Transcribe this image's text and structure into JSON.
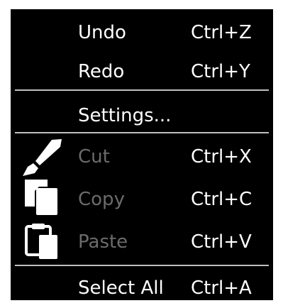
{
  "menu": {
    "undo": {
      "label": "Undo",
      "shortcut": "Ctrl+Z"
    },
    "redo": {
      "label": "Redo",
      "shortcut": "Ctrl+Y"
    },
    "settings": {
      "label": "Settings..."
    },
    "cut": {
      "label": "Cut",
      "shortcut": "Ctrl+X",
      "icon": "brush-icon",
      "enabled": false
    },
    "copy": {
      "label": "Copy",
      "shortcut": "Ctrl+C",
      "icon": "copy-icon",
      "enabled": false
    },
    "paste": {
      "label": "Paste",
      "shortcut": "Ctrl+V",
      "icon": "clipboard-icon",
      "enabled": false
    },
    "select_all": {
      "label": "Select All",
      "shortcut": "Ctrl+A"
    }
  },
  "colors": {
    "background": "#000000",
    "text": "#ffffff",
    "disabled_text": "#6b6b6b",
    "separator": "#bfbfbf"
  }
}
